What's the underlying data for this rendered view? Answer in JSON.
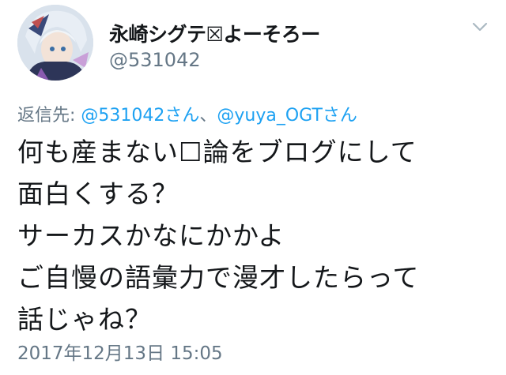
{
  "tweet": {
    "display_name": "永崎シグテ☒よーそろー",
    "handle": "@531042",
    "reply_prefix": "返信先: ",
    "reply_mention_1": "@531042さん",
    "reply_separator": "、",
    "reply_mention_2": "@yuya_OGTさん",
    "text": "何も産まない☐論をブログにして\n面白くする？\nサーカスかなにかかよ\nご自慢の語彙力で漫才したらって\n話じゃね？",
    "timestamp": "2017年12月13日 15:05",
    "avatar_icon": "user-avatar-icon",
    "menu_icon": "chevron-down-icon"
  },
  "colors": {
    "text_primary": "#14171a",
    "text_secondary": "#657786",
    "link": "#1da1f2",
    "background": "#ffffff"
  }
}
